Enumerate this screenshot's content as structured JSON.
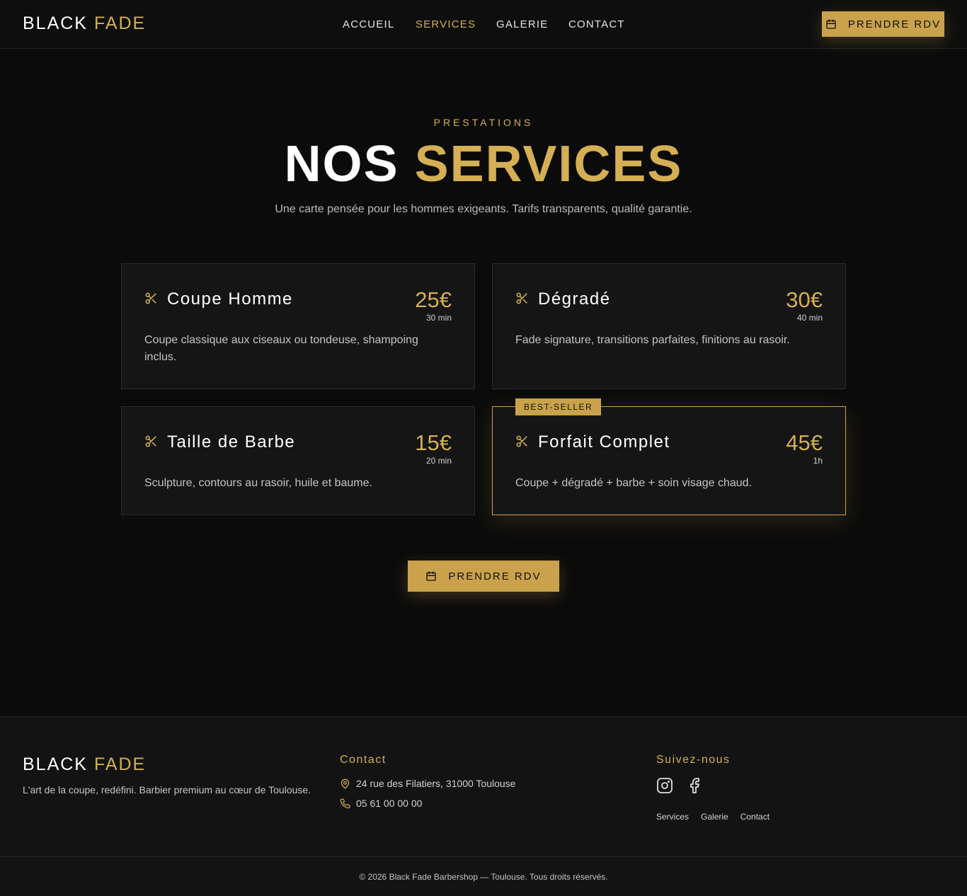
{
  "header": {
    "logo": {
      "first": "BLACK",
      "second": "FADE"
    },
    "nav": [
      {
        "label": "ACCUEIL",
        "active": false
      },
      {
        "label": "SERVICES",
        "active": true
      },
      {
        "label": "GALERIE",
        "active": false
      },
      {
        "label": "CONTACT",
        "active": false
      }
    ],
    "cta_label": "PRENDRE RDV",
    "cta_icon": "calendar-icon"
  },
  "hero": {
    "eyebrow": "PRESTATIONS",
    "title_first": "NOS",
    "title_second": "SERVICES",
    "subtitle": "Une carte pensée pour les hommes exigeants. Tarifs transparents, qualité garantie."
  },
  "services": [
    {
      "name": "Coupe Homme",
      "price": "25€",
      "duration": "30 min",
      "description": "Coupe classique aux ciseaux ou tondeuse, shampoing inclus.",
      "icon": "scissors-icon"
    },
    {
      "name": "Dégradé",
      "price": "30€",
      "duration": "40 min",
      "description": "Fade signature, transitions parfaites, finitions au rasoir.",
      "icon": "scissors-icon"
    },
    {
      "name": "Taille de Barbe",
      "price": "15€",
      "duration": "20 min",
      "description": "Sculpture, contours au rasoir, huile et baume.",
      "icon": "scissors-icon"
    },
    {
      "name": "Forfait Complet",
      "price": "45€",
      "duration": "1h",
      "description": "Coupe + dégradé + barbe + soin visage chaud.",
      "icon": "scissors-icon",
      "badge": "BEST-SELLER",
      "featured": true
    }
  ],
  "cta": {
    "label": "PRENDRE RDV",
    "icon": "calendar-icon"
  },
  "footer": {
    "logo": {
      "first": "BLACK",
      "second": "FADE"
    },
    "tagline": "L'art de la coupe, redéfini. Barbier premium au cœur de Toulouse.",
    "contact_heading": "Contact",
    "address": "24 rue des Filatiers, 31000 Toulouse",
    "phone": "05 61 00 00 00",
    "social_heading": "Suivez-nous",
    "socials": [
      "instagram-icon",
      "facebook-icon"
    ],
    "links": [
      "Services",
      "Galerie",
      "Contact"
    ],
    "copyright": "© 2026 Black Fade Barbershop — Toulouse. Tous droits réservés."
  },
  "colors": {
    "accent": "#caa24b",
    "accent_text": "#d4af53",
    "background": "#0b0b0b",
    "card": "#151515"
  }
}
